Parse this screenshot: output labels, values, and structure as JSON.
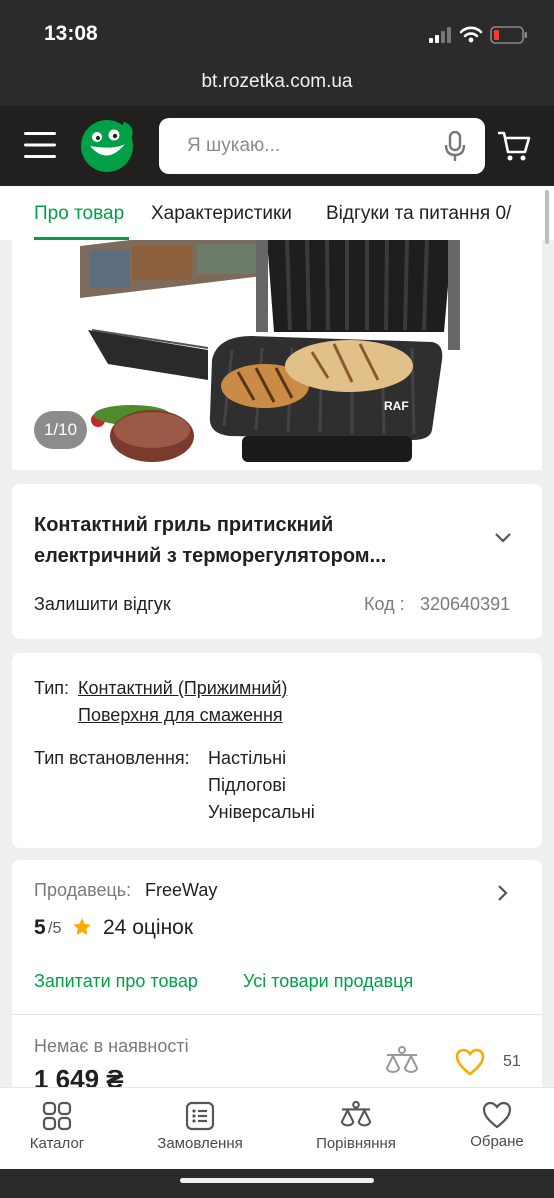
{
  "status_bar": {
    "time": "13:08"
  },
  "browser": {
    "url": "bt.rozetka.com.ua"
  },
  "header": {
    "search_placeholder": "Я шукаю..."
  },
  "tabs": [
    {
      "label": "Про товар",
      "active": true
    },
    {
      "label": "Характеристики",
      "active": false
    },
    {
      "label": "Відгуки та питання 0/",
      "active": false
    }
  ],
  "gallery": {
    "counter": "1/10"
  },
  "product": {
    "title_line1": "Контактний гриль притискний",
    "title_line2": "електричний з терморегулятором...",
    "leave_review": "Залишити відгук",
    "code_label": "Код :",
    "code_value": "320640391"
  },
  "specs": {
    "type_label": "Тип:",
    "type_values": [
      "Контактний (Прижимний)",
      "Поверхня для смаження"
    ],
    "install_label": "Тип встановлення:",
    "install_values": [
      "Настільні",
      "Підлогові",
      "Універсальні"
    ]
  },
  "seller": {
    "label": "Продавець:",
    "name": "FreeWay",
    "rating": "5",
    "rating_max": "/5",
    "reviews": "24 оцінок",
    "ask_link": "Запитати про товар",
    "all_goods_link": "Усі товари продавця"
  },
  "buy": {
    "availability": "Немає в наявності",
    "price": "1 649 ₴",
    "favorites_count": "51"
  },
  "bottom_nav": [
    {
      "label": "Каталог"
    },
    {
      "label": "Замовлення"
    },
    {
      "label": "Порівняння"
    },
    {
      "label": "Обране"
    }
  ],
  "colors": {
    "accent": "#00a046",
    "header": "#221f1f",
    "star": "#ffa900"
  }
}
